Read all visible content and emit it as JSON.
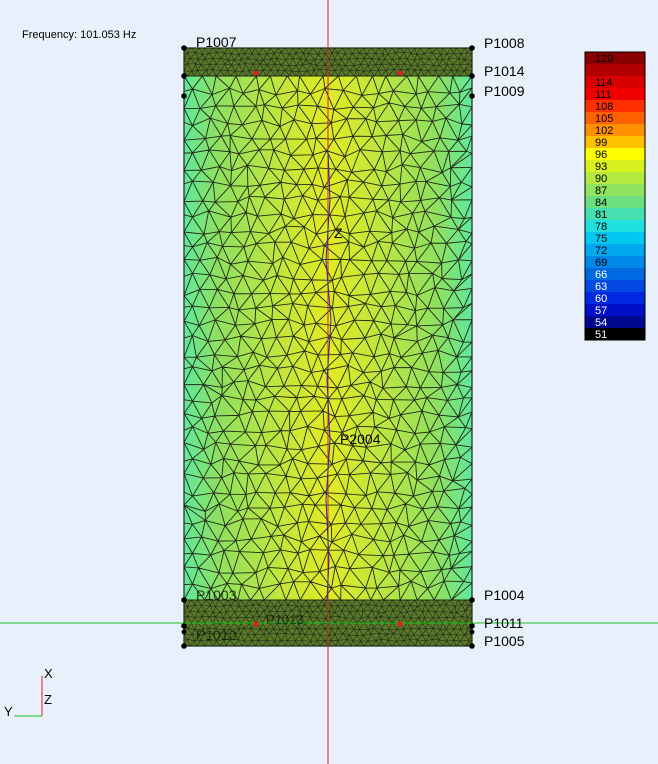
{
  "frequency_label": "Frequency: 101.053 Hz",
  "points": {
    "p1007": "P1007",
    "p1008": "P1008",
    "p1014": "P1014",
    "p1009": "P1009",
    "p1004": "P1004",
    "p1011": "P1011",
    "p1005": "P1005",
    "p1003": "P1003",
    "p2004": "P2004",
    "p1010": "P1010",
    "p1013": "P1013"
  },
  "center_label": "Z",
  "triad": {
    "x": "X",
    "y": "Y",
    "z": "Z"
  },
  "colors": {
    "background": "#e8f1fb",
    "mesh_line": "#1f2a18",
    "cursor_vertical": "#e02020",
    "cursor_horizontal": "#20c020",
    "center_line": "#2030a0",
    "field_low": "#5fe89a",
    "field_mid": "#9fe050",
    "field_high": "#e6ea20"
  },
  "legend": [
    {
      "value": "120",
      "color": "#8a0000"
    },
    {
      "value": "",
      "color": "#b00000"
    },
    {
      "value": "114",
      "color": "#d80000"
    },
    {
      "value": "111",
      "color": "#f00000"
    },
    {
      "value": "108",
      "color": "#ff3000"
    },
    {
      "value": "105",
      "color": "#ff6000"
    },
    {
      "value": "102",
      "color": "#ff9000"
    },
    {
      "value": "99",
      "color": "#ffc000"
    },
    {
      "value": "96",
      "color": "#ffff00"
    },
    {
      "value": "93",
      "color": "#d8f020"
    },
    {
      "value": "90",
      "color": "#b4ea40"
    },
    {
      "value": "87",
      "color": "#90e460"
    },
    {
      "value": "84",
      "color": "#6ce080"
    },
    {
      "value": "81",
      "color": "#44e0b0"
    },
    {
      "value": "78",
      "color": "#20e0e0"
    },
    {
      "value": "75",
      "color": "#00c8f0"
    },
    {
      "value": "72",
      "color": "#00a8f0"
    },
    {
      "value": "69",
      "color": "#0088e8"
    },
    {
      "value": "66",
      "color": "#0068e0"
    },
    {
      "value": "63",
      "color": "#0048e0"
    },
    {
      "value": "60",
      "color": "#0028e0"
    },
    {
      "value": "57",
      "color": "#0010c8"
    },
    {
      "value": "54",
      "color": "#000890"
    },
    {
      "value": "51",
      "color": "#000000"
    }
  ]
}
